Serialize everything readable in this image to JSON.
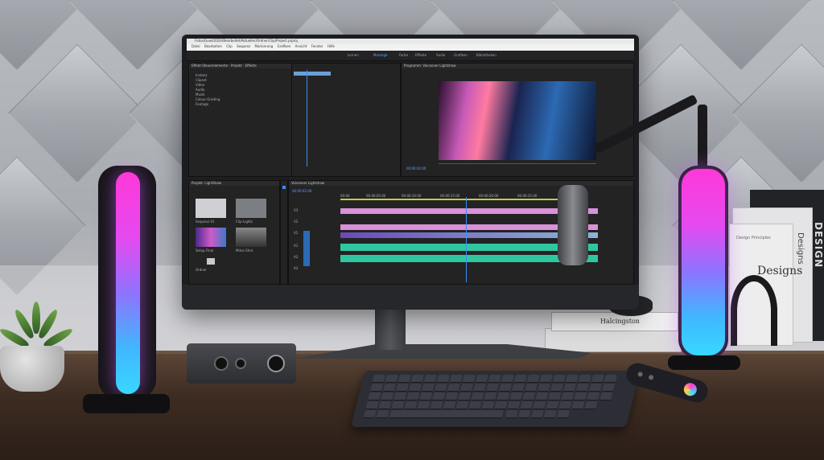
{
  "premiere": {
    "titlebar": "Fotos/Guest2024/Bearbeitet/Aktueller/Ordner/Clip/Project.prproj",
    "menu": [
      "Datei",
      "Bearbeiten",
      "Clip",
      "Sequenz",
      "Markierung",
      "Grafiken",
      "Ansicht",
      "Fenster",
      "Hilfe"
    ],
    "workspace_tabs": [
      "Lernen",
      "Montage",
      "Farbe",
      "Effekte",
      "Audio",
      "Grafiken",
      "Bibliotheken"
    ],
    "source_panel": {
      "tabs": [
        "Effekt-Steuerelemente",
        "Projekt",
        "Effekte",
        "Audioclip-Mischer"
      ],
      "items": [
        "Instanz",
        "Clipset",
        "Video",
        "Audio",
        "Musik",
        "Colour-Grading",
        "Footage"
      ]
    },
    "program_panel": {
      "title": "Programm: Voiceover Lightshow",
      "timecode": "00:00:02:00"
    },
    "project_panel": {
      "title": "Projekt: LightShow",
      "thumbs": [
        "Sequenz 01",
        "Clip-Lights",
        "Setup Final",
        "Mikro Shot",
        "Ordner"
      ]
    },
    "timeline": {
      "title": "Voiceover Lightshow",
      "timecode": "00:00:02:00",
      "ruler": [
        "00:00",
        "00:00:05:00",
        "00:00:10:00",
        "00:00:15:00",
        "00:00:20:00",
        "00:00:25:00"
      ],
      "tracks": [
        "V3",
        "V2",
        "V1",
        "A1",
        "A2",
        "A3"
      ]
    }
  },
  "books": {
    "book1_spine": "DESIGN",
    "book2_title": "Designs",
    "book2_sub": "Design Principles",
    "book3_title": "Designs",
    "book4_title": "Halcingston"
  },
  "colors": {
    "light_top": "#ff38d8",
    "light_bottom": "#39d7ff",
    "premiere_playhead": "#3a8df5",
    "clip_pink": "#d991d8",
    "clip_green": "#2fc7a0"
  }
}
